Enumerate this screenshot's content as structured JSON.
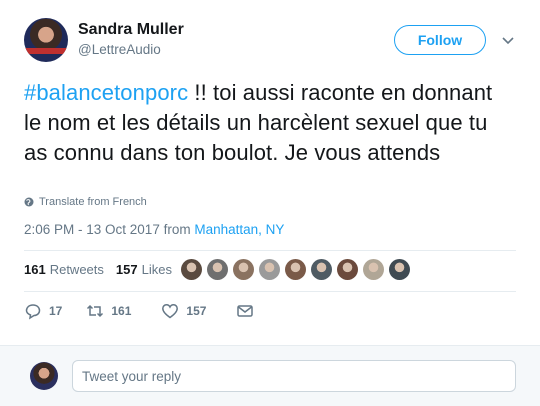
{
  "author": {
    "name": "Sandra Muller",
    "handle": "@LettreAudio"
  },
  "follow_label": "Follow",
  "tweet": {
    "hashtag": "#balancetonporc",
    "text": " !!  toi aussi raconte en donnant le nom et les détails un harcèlent sexuel que tu as connu dans ton boulot. Je vous attends"
  },
  "translate_label": "Translate from French",
  "meta": {
    "timestamp": "2:06 PM - 13 Oct 2017 from ",
    "location": "Manhattan, NY"
  },
  "stats": {
    "retweets": "161",
    "retweets_label": "Retweets",
    "likes": "157",
    "likes_label": "Likes"
  },
  "liker_faces": [
    "#5a4a3f",
    "#6f6f6f",
    "#8a7260",
    "#9a9a9a",
    "#7a5a48",
    "#4f5b63",
    "#6b4a3c",
    "#b0a696",
    "#3f4a52"
  ],
  "actions": {
    "replies": "17",
    "retweets": "161",
    "likes": "157"
  },
  "reply_placeholder": "Tweet your reply",
  "colors": {
    "accent": "#1da1f2",
    "muted": "#657786"
  }
}
